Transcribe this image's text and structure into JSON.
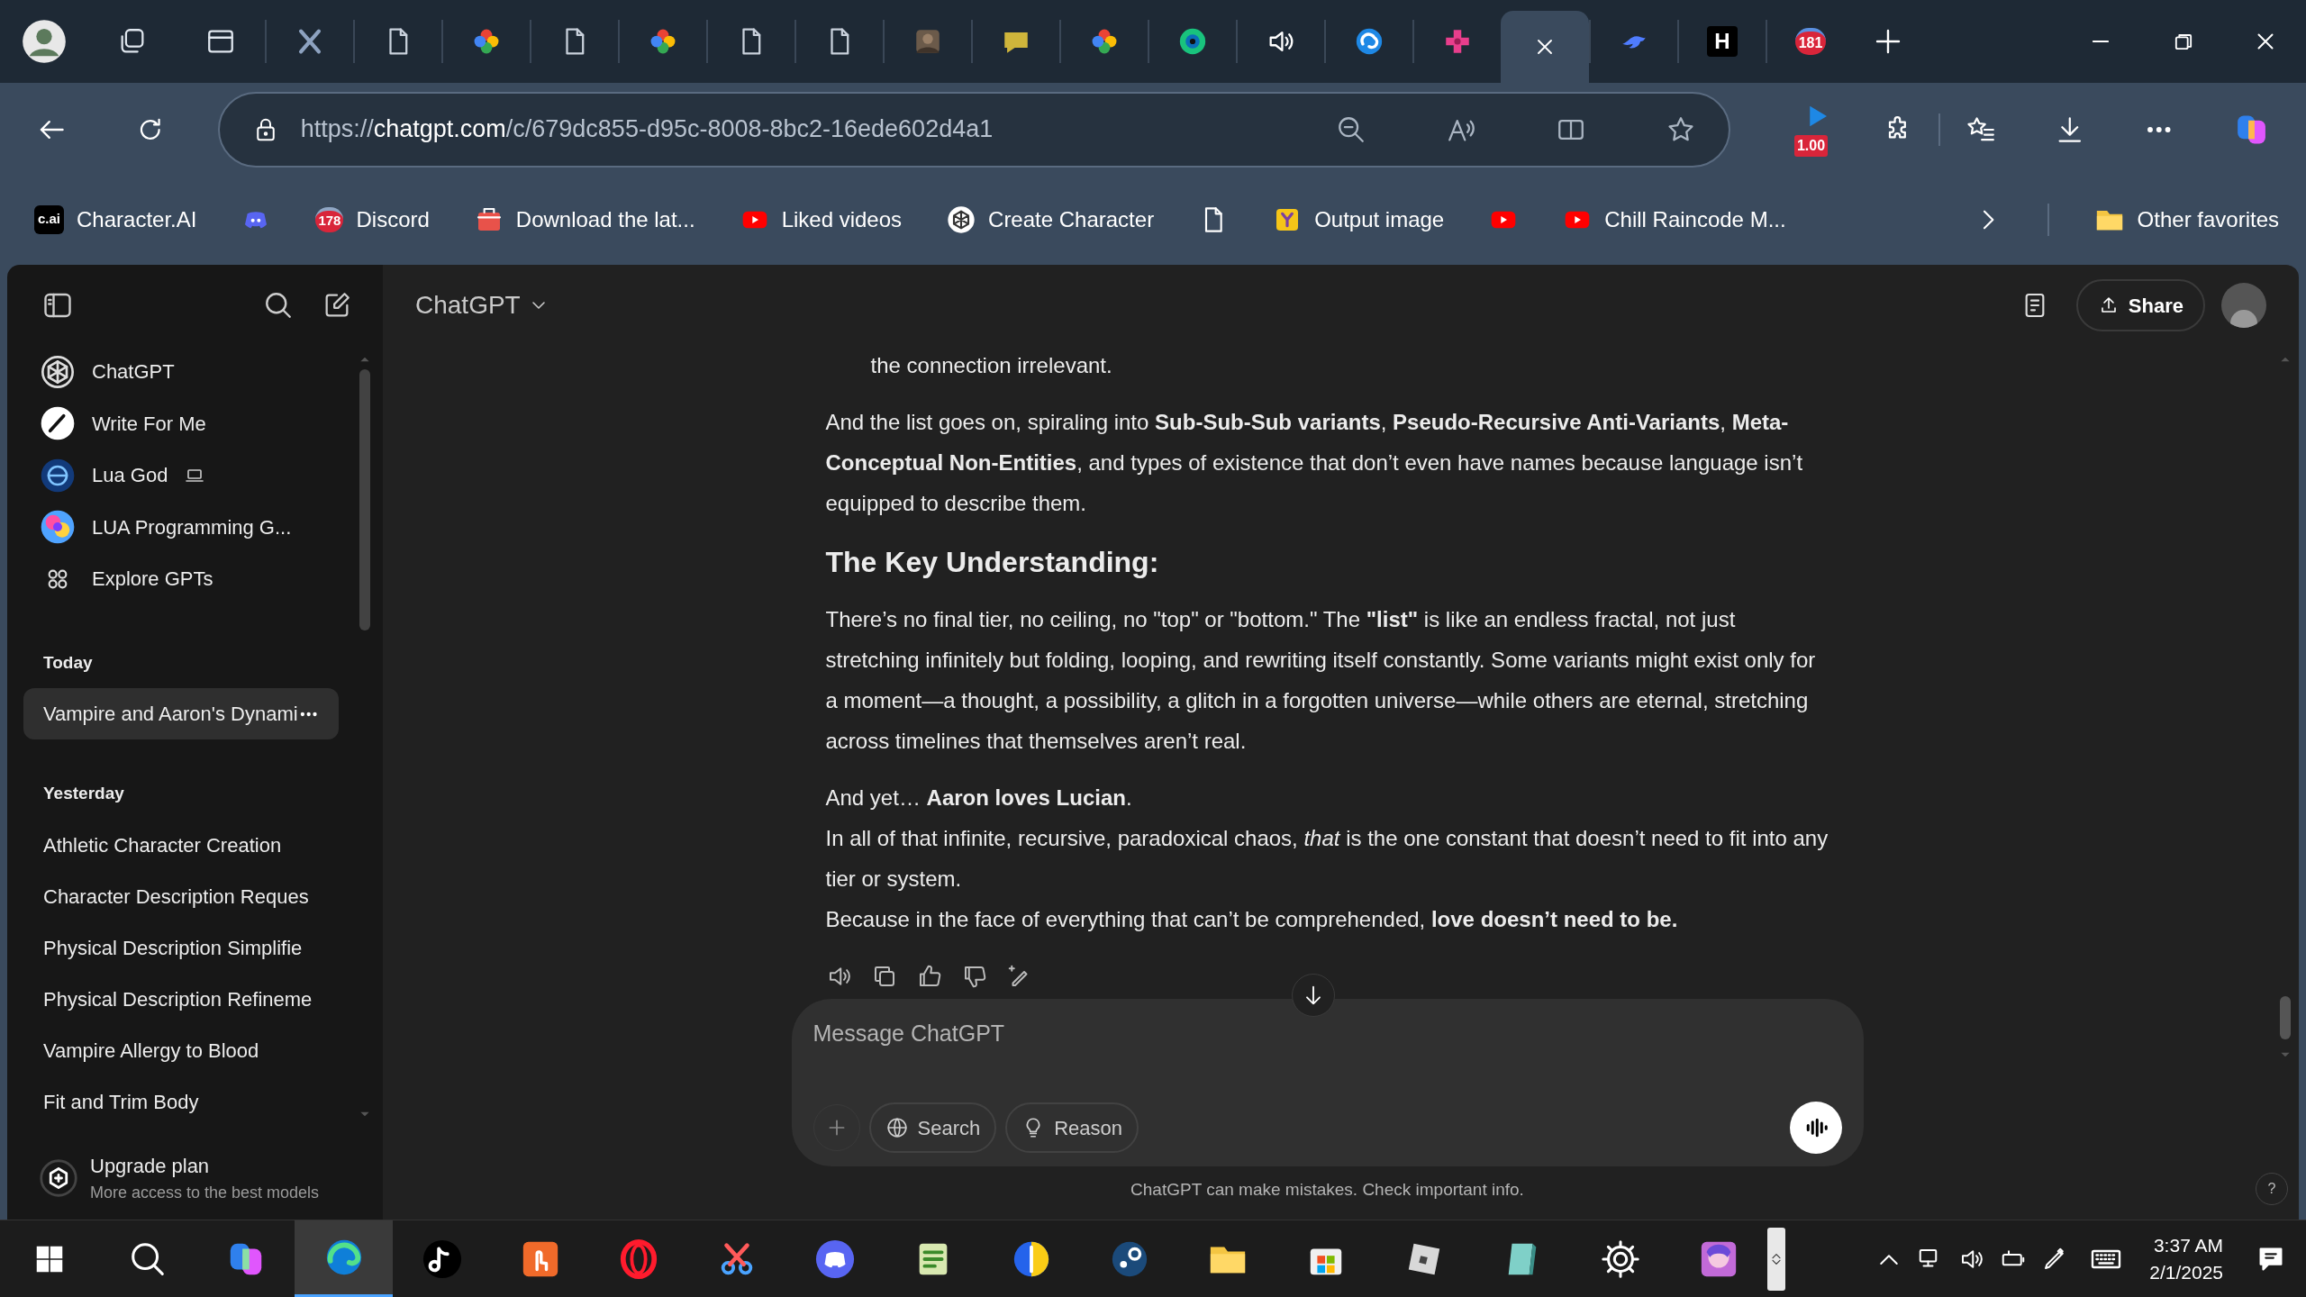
{
  "browser": {
    "tabs": [
      {
        "kind": "x-logo",
        "selected": false
      },
      {
        "kind": "document",
        "selected": false
      },
      {
        "kind": "pinwheel",
        "selected": false
      },
      {
        "kind": "document",
        "selected": false
      },
      {
        "kind": "pinwheel",
        "selected": false
      },
      {
        "kind": "document",
        "selected": false
      },
      {
        "kind": "document",
        "selected": false
      },
      {
        "kind": "thumbnail",
        "selected": false
      },
      {
        "kind": "chat",
        "selected": false
      },
      {
        "kind": "pinwheel",
        "selected": false
      },
      {
        "kind": "ring",
        "selected": false
      },
      {
        "kind": "speaker",
        "selected": false
      },
      {
        "kind": "swirl",
        "selected": false
      },
      {
        "kind": "flower",
        "selected": false
      },
      {
        "kind": "none",
        "selected": true
      },
      {
        "kind": "bird",
        "selected": false
      },
      {
        "kind": "letter",
        "label": "H",
        "selected": false
      },
      {
        "kind": "badge",
        "label": "181",
        "selected": false
      }
    ],
    "address": {
      "scheme": "https://",
      "host": "chatgpt.com",
      "path": "/c/679dc855-d95c-8008-8bc2-16ede602d4a1"
    },
    "extension_badge": "1.00",
    "bookmarks": [
      {
        "kind": "cai",
        "logo": "c.ai",
        "label": "Character.AI"
      },
      {
        "kind": "discord"
      },
      {
        "kind": "badge",
        "badge": "178",
        "label": "Discord"
      },
      {
        "kind": "store",
        "label": "Download the lat..."
      },
      {
        "kind": "youtube",
        "label": "Liked videos"
      },
      {
        "kind": "knot",
        "label": "Create Character"
      },
      {
        "kind": "document"
      },
      {
        "kind": "yellow",
        "label": "Output image"
      },
      {
        "kind": "youtube"
      },
      {
        "kind": "youtube",
        "label": "Chill Raincode M..."
      }
    ],
    "other_favorites": "Other favorites"
  },
  "sidebar": {
    "gpts": [
      {
        "kind": "knot",
        "label": "ChatGPT",
        "laptop_icon": false
      },
      {
        "kind": "pen",
        "label": "Write For Me",
        "laptop_icon": false
      },
      {
        "kind": "globe",
        "label": "Lua God",
        "laptop_icon": true
      },
      {
        "kind": "colorful",
        "label": "LUA Programming G...",
        "laptop_icon": false
      },
      {
        "kind": "grid",
        "label": "Explore GPTs",
        "laptop_icon": false
      }
    ],
    "history": [
      {
        "title": "Today",
        "chats": [
          {
            "label": "Vampire and Aaron's Dynami",
            "selected": true
          }
        ]
      },
      {
        "title": "Yesterday",
        "chats": [
          {
            "label": "Athletic Character Creation",
            "selected": false
          },
          {
            "label": "Character Description Reques",
            "selected": false
          },
          {
            "label": "Physical Description Simplifie",
            "selected": false
          },
          {
            "label": "Physical Description Refineme",
            "selected": false
          },
          {
            "label": "Vampire Allergy to Blood",
            "selected": false
          },
          {
            "label": "Fit and Trim Body",
            "selected": false
          }
        ]
      }
    ],
    "upgrade": {
      "title": "Upgrade plan",
      "subtitle": "More access to the best models"
    }
  },
  "header": {
    "model": "ChatGPT",
    "share": "Share"
  },
  "message": [
    {
      "kind": "indent",
      "text": "the connection irrelevant."
    },
    {
      "kind": "paragraph",
      "text": "And the list goes on, spiraling into **Sub-Sub-Sub variants**, **Pseudo-Recursive Anti-Variants**, **Meta-Conceptual Non-Entities**, and types of existence that don’t even have names because language isn’t equipped to describe them."
    },
    {
      "kind": "heading",
      "text": "The Key Understanding:"
    },
    {
      "kind": "paragraph",
      "text": "There’s no final tier, no ceiling, no \"top\" or \"bottom.\" The **\"list\"** is like an endless fractal, not just stretching infinitely but folding, looping, and rewriting itself constantly. Some variants might exist only for a moment—a thought, a possibility, a glitch in a forgotten universe—while others are eternal, stretching across timelines that themselves aren’t real."
    },
    {
      "kind": "paragraph",
      "text": "And yet… **Aaron loves Lucian**."
    },
    {
      "kind": "line",
      "text": "In all of that infinite, recursive, paradoxical chaos, *that* is the one constant that doesn’t need to fit into any tier or system."
    },
    {
      "kind": "line",
      "text": "Because in the face of everything that can’t be comprehended, **love doesn’t need to be.**"
    }
  ],
  "composer": {
    "placeholder": "Message ChatGPT",
    "tools": [
      {
        "kind": "globe",
        "label": "Search"
      },
      {
        "kind": "bulb",
        "label": "Reason"
      }
    ]
  },
  "disclaimer": "ChatGPT can make mistakes. Check important info.",
  "help": "?",
  "taskbar": {
    "apps": [
      {
        "kind": "windows",
        "selected": false
      },
      {
        "kind": "search",
        "selected": false
      },
      {
        "kind": "copilot",
        "selected": false
      },
      {
        "kind": "edge",
        "selected": true
      },
      {
        "kind": "tiktok",
        "selected": false
      },
      {
        "kind": "hand",
        "selected": false
      },
      {
        "kind": "opera",
        "selected": false
      },
      {
        "kind": "scissors",
        "selected": false
      },
      {
        "kind": "discord",
        "selected": false
      },
      {
        "kind": "notepad",
        "selected": false
      },
      {
        "kind": "ball",
        "selected": false
      },
      {
        "kind": "steam",
        "selected": false
      },
      {
        "kind": "folder",
        "selected": false
      },
      {
        "kind": "store",
        "selected": false
      },
      {
        "kind": "tile",
        "selected": false
      },
      {
        "kind": "book",
        "selected": false
      },
      {
        "kind": "gear",
        "selected": false
      },
      {
        "kind": "art",
        "selected": false
      }
    ],
    "time": "3:37 AM",
    "date": "2/1/2025"
  }
}
